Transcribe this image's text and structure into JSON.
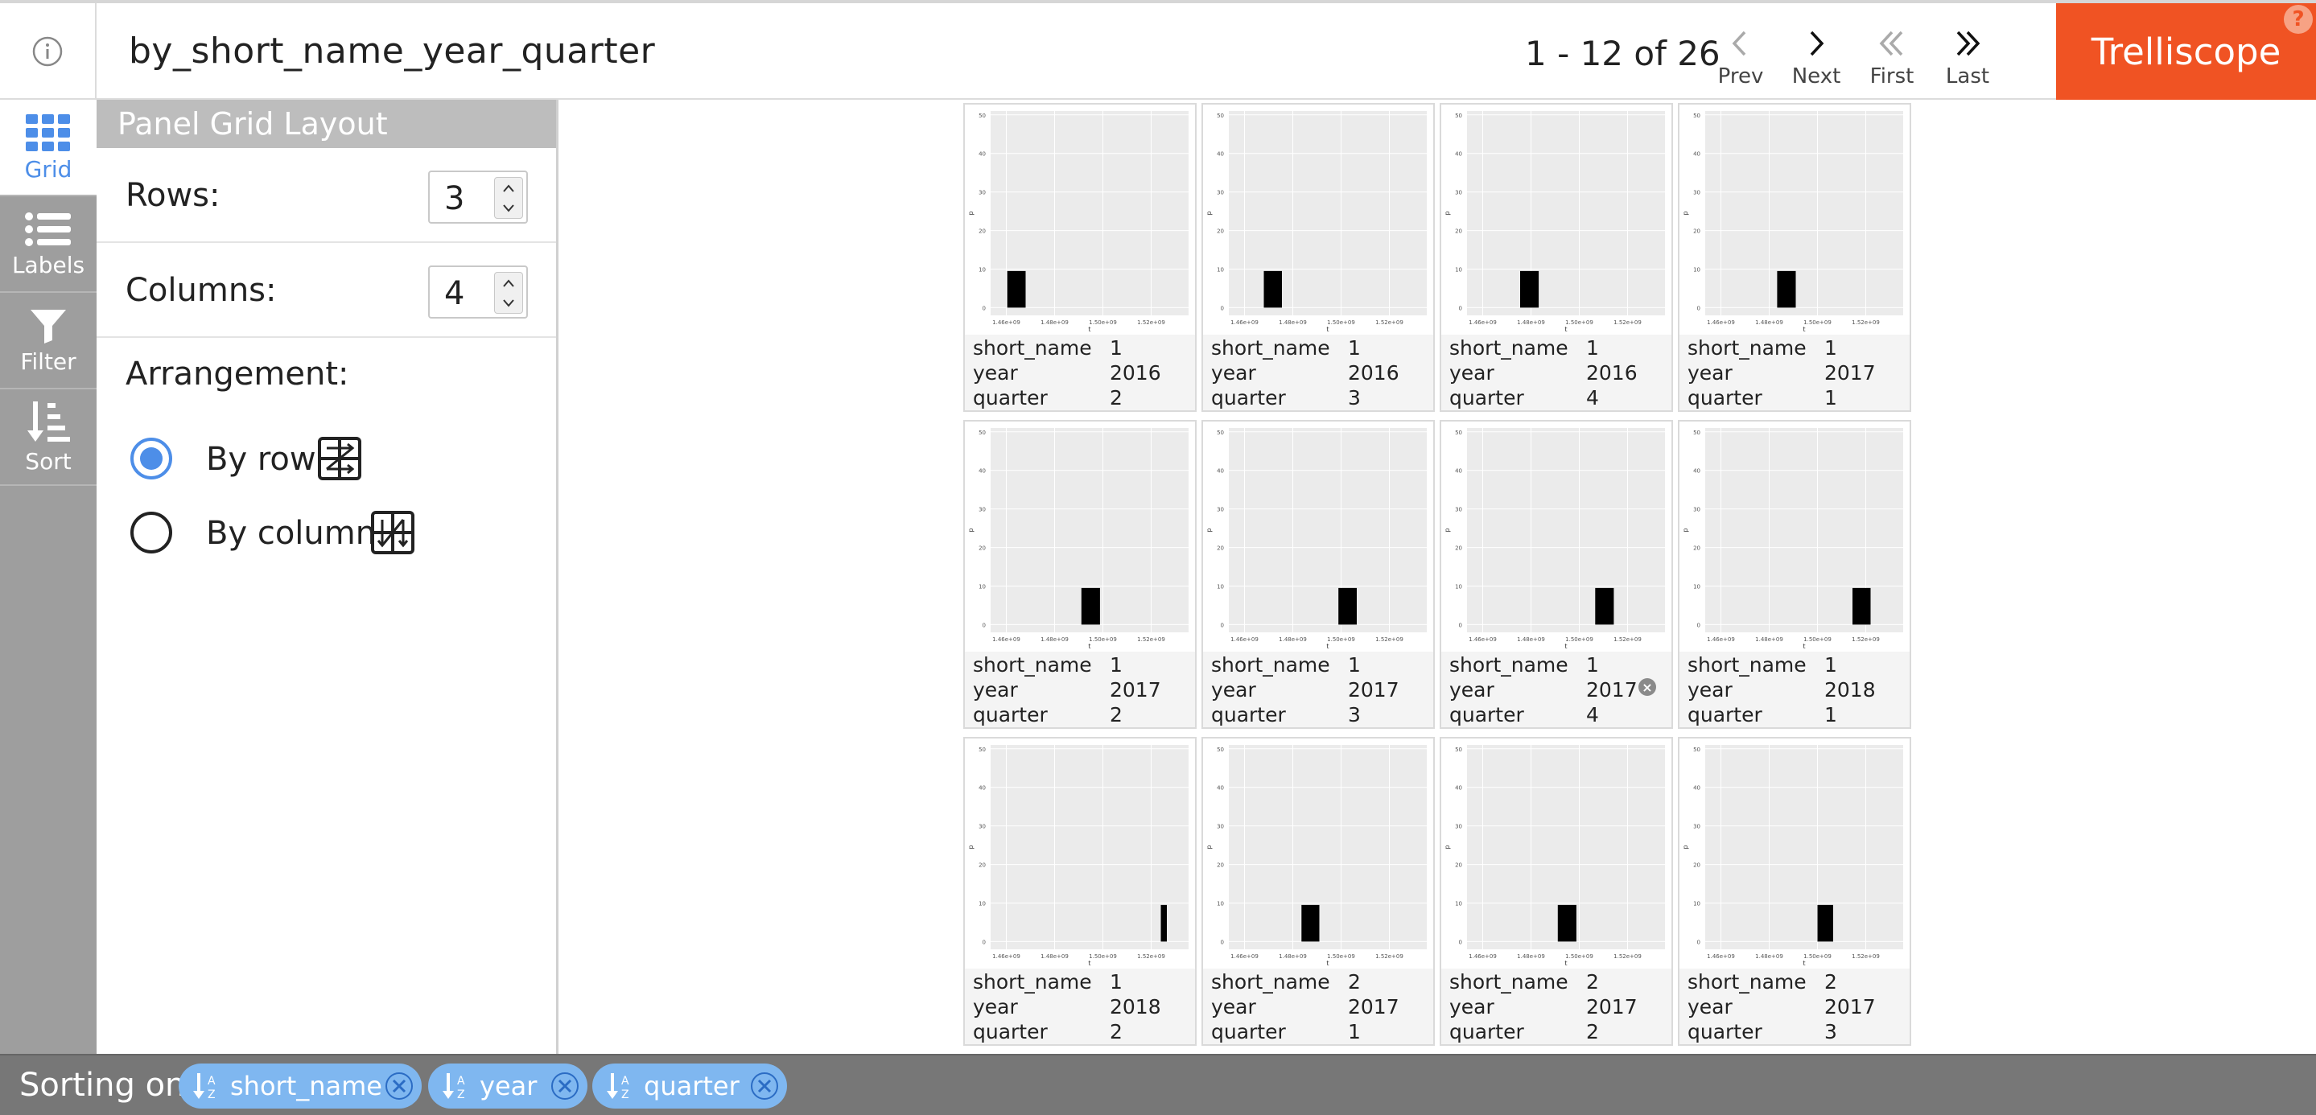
{
  "header": {
    "title": "by_short_name_year_quarter",
    "pager_text": "1 - 12 of 26",
    "nav": {
      "prev": "Prev",
      "next": "Next",
      "first": "First",
      "last": "Last"
    },
    "brand": "Trelliscope",
    "help": "?"
  },
  "sidebar": {
    "items": [
      {
        "label": "Grid",
        "icon": "grid-icon",
        "active": true
      },
      {
        "label": "Labels",
        "icon": "list-icon"
      },
      {
        "label": "Filter",
        "icon": "filter-icon"
      },
      {
        "label": "Sort",
        "icon": "sort-icon"
      }
    ]
  },
  "control_panel": {
    "title": "Panel Grid Layout",
    "rows_label": "Rows:",
    "rows_value": "3",
    "columns_label": "Columns:",
    "columns_value": "4",
    "arrangement_label": "Arrangement:",
    "by_row_label": "By row",
    "by_column_label": "By column",
    "selected": "by_row"
  },
  "panel_labels": {
    "k1": "short_name",
    "k2": "year",
    "k3": "quarter"
  },
  "plot_axis": {
    "x_ticks": [
      "1.46e+09",
      "1.48e+09",
      "1.50e+09",
      "1.52e+09"
    ],
    "y_ticks": [
      "0",
      "10",
      "20",
      "30",
      "40",
      "50"
    ],
    "x_label": "t",
    "y_label": "p"
  },
  "panels": [
    {
      "short_name": "1",
      "year": "2016",
      "quarter": "2",
      "bar_start": 1460400000.0,
      "bar_end": 1468000000.0
    },
    {
      "short_name": "1",
      "year": "2016",
      "quarter": "3",
      "bar_start": 1468000000.0,
      "bar_end": 1475500000.0
    },
    {
      "short_name": "1",
      "year": "2016",
      "quarter": "4",
      "bar_start": 1475500000.0,
      "bar_end": 1483200000.0
    },
    {
      "short_name": "1",
      "year": "2017",
      "quarter": "1",
      "bar_start": 1483300000.0,
      "bar_end": 1491000000.0
    },
    {
      "short_name": "1",
      "year": "2017",
      "quarter": "2",
      "bar_start": 1491100000.0,
      "bar_end": 1498800000.0
    },
    {
      "short_name": "1",
      "year": "2017",
      "quarter": "3",
      "bar_start": 1498900000.0,
      "bar_end": 1506500000.0
    },
    {
      "short_name": "1",
      "year": "2017",
      "quarter": "4",
      "bar_start": 1506600000.0,
      "bar_end": 1514300000.0
    },
    {
      "short_name": "1",
      "year": "2018",
      "quarter": "1",
      "bar_start": 1514500000.0,
      "bar_end": 1522000000.0
    },
    {
      "short_name": "1",
      "year": "2018",
      "quarter": "2",
      "bar_start": 1524000000.0,
      "bar_end": 1526500000.0
    },
    {
      "short_name": "2",
      "year": "2017",
      "quarter": "1",
      "bar_start": 1483600000.0,
      "bar_end": 1491000000.0
    },
    {
      "short_name": "2",
      "year": "2017",
      "quarter": "2",
      "bar_start": 1491100000.0,
      "bar_end": 1498800000.0
    },
    {
      "short_name": "2",
      "year": "2017",
      "quarter": "3",
      "bar_start": 1500000000.0,
      "bar_end": 1506500000.0
    }
  ],
  "footer": {
    "label": "Sorting on:",
    "chips": [
      {
        "label": "short_name"
      },
      {
        "label": "year"
      },
      {
        "label": "quarter"
      }
    ]
  },
  "colors": {
    "brand": "#f05323",
    "accent": "#4d8ee8",
    "chip": "#7fb7f0",
    "sidebar": "#9e9e9e"
  }
}
